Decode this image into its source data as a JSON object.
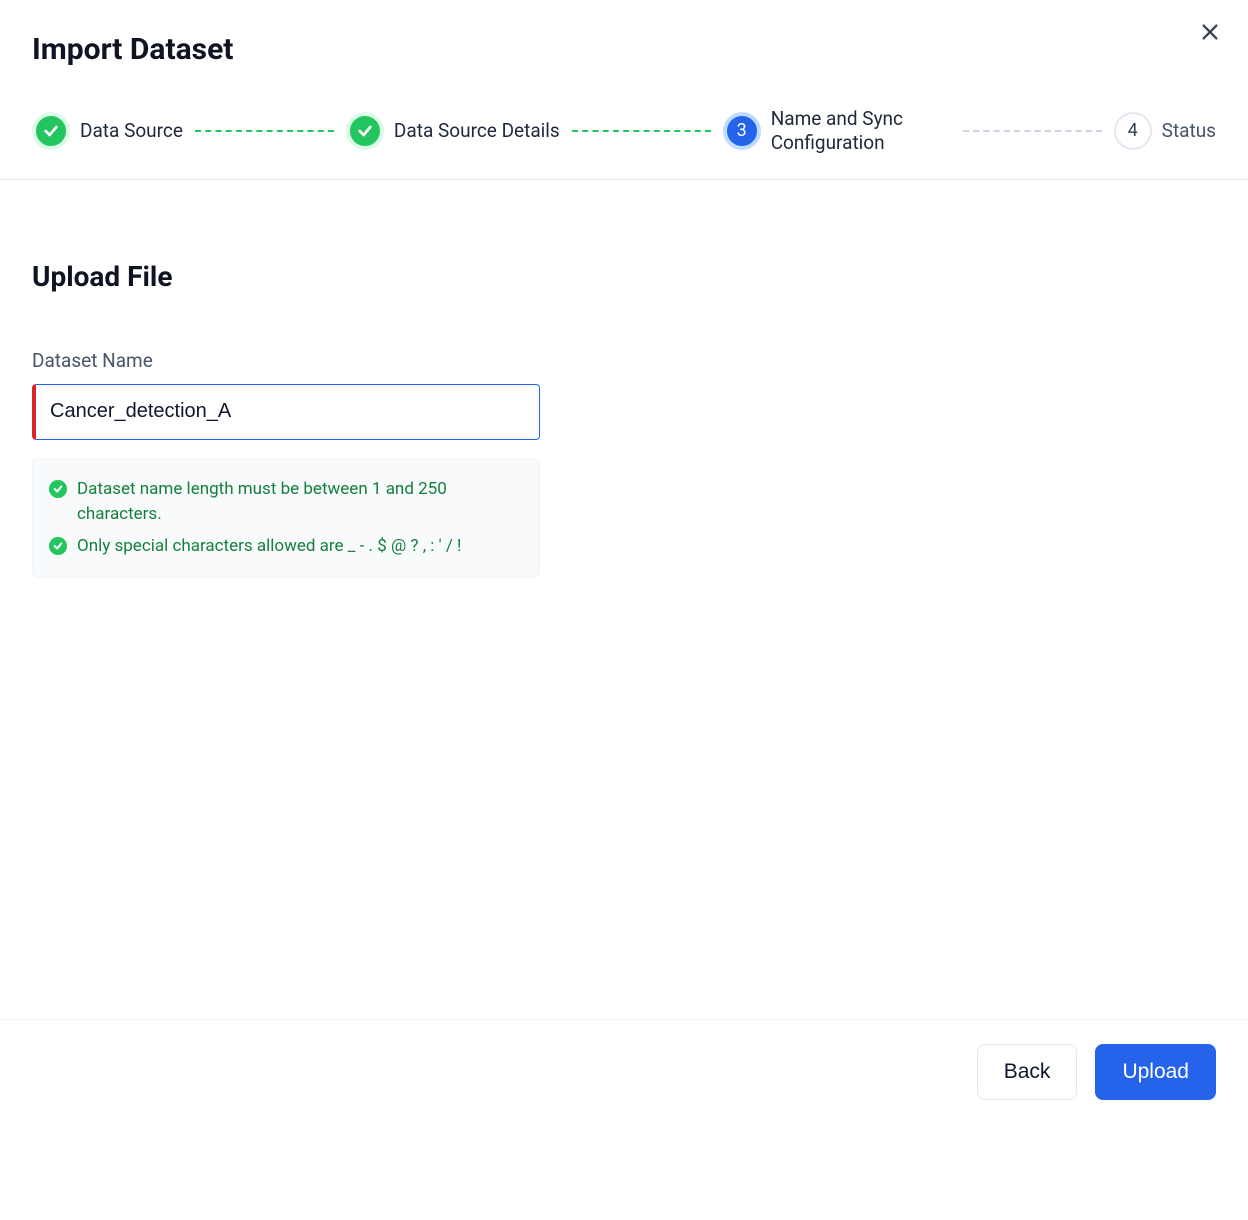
{
  "header": {
    "title": "Import Dataset"
  },
  "stepper": {
    "steps": [
      {
        "label": "Data Source",
        "state": "completed",
        "number": "1"
      },
      {
        "label": "Data Source Details",
        "state": "completed",
        "number": "2"
      },
      {
        "label": "Name and Sync Configuration",
        "state": "active",
        "number": "3"
      },
      {
        "label": "Status",
        "state": "upcoming",
        "number": "4"
      }
    ]
  },
  "section": {
    "title": "Upload File"
  },
  "form": {
    "dataset_name_label": "Dataset Name",
    "dataset_name_value": "Cancer_detection_A"
  },
  "validation": {
    "rules": [
      "Dataset name length must be between 1 and 250 characters.",
      "Only special characters allowed are _ - . $ @ ? , : ' / !"
    ]
  },
  "footer": {
    "back_label": "Back",
    "upload_label": "Upload"
  }
}
